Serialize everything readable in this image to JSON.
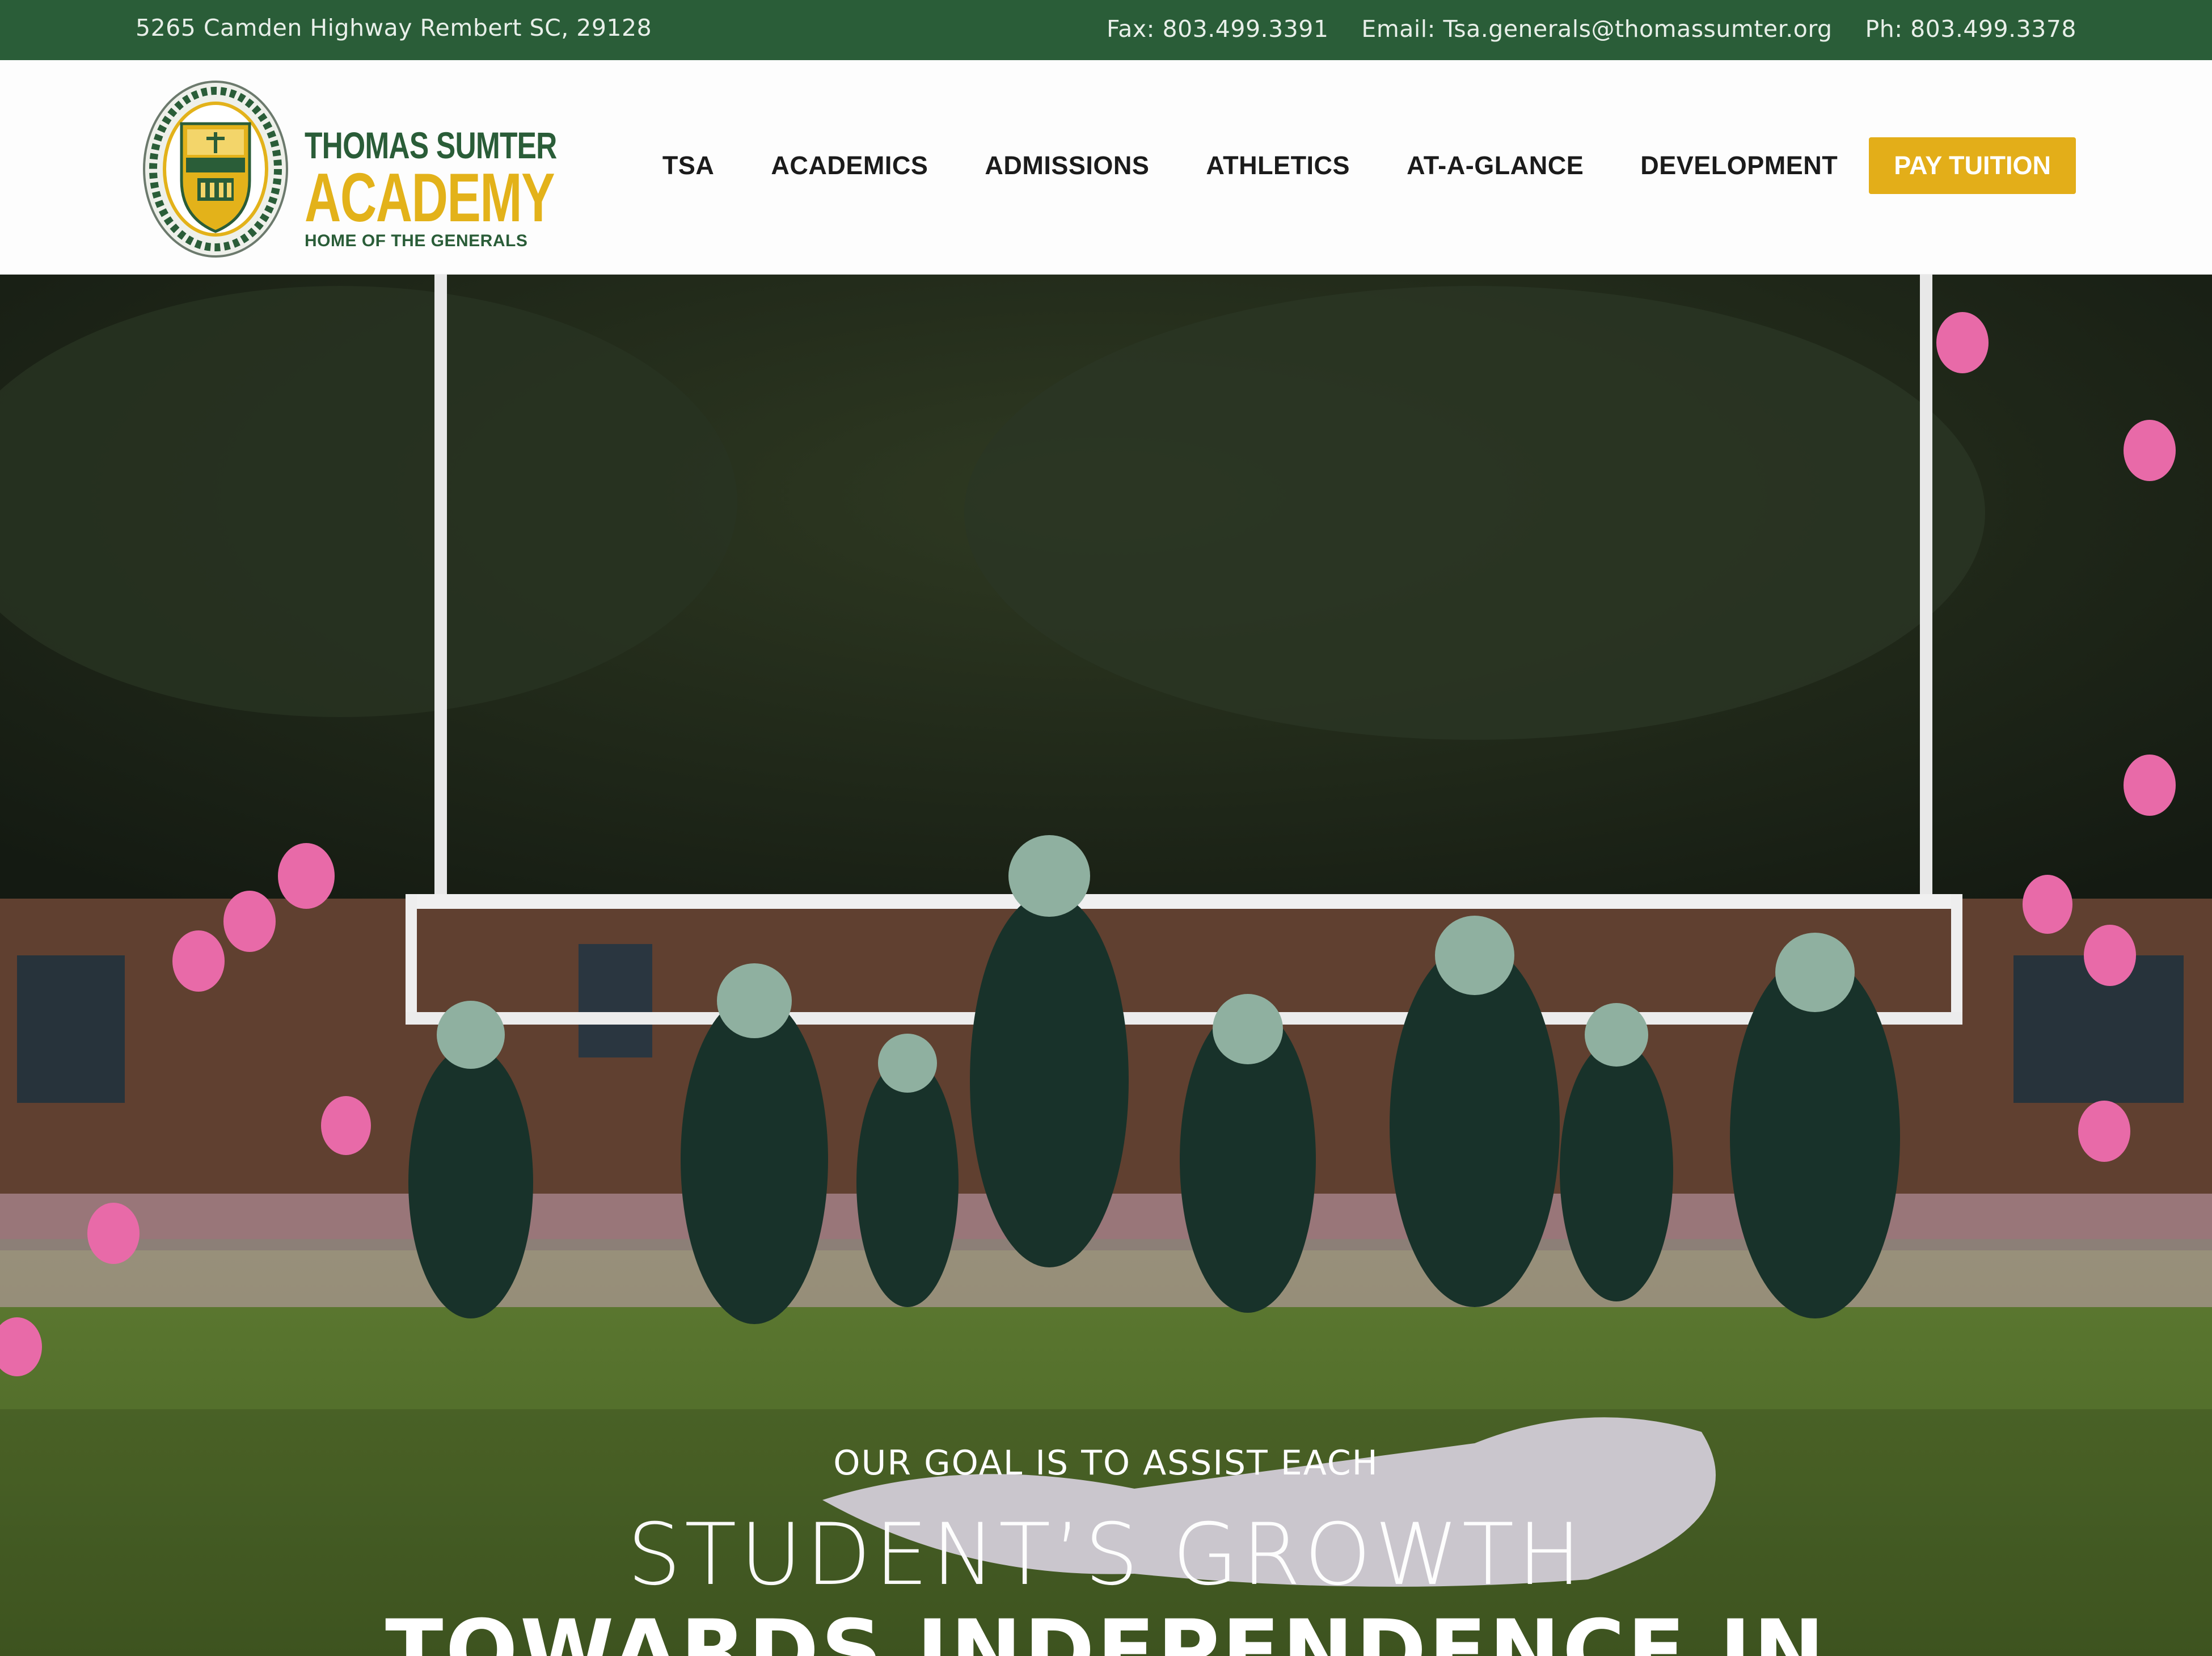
{
  "topbar": {
    "address": "5265 Camden Highway Rembert SC, 29128",
    "fax": "Fax: 803.499.3391",
    "email": "Email: Tsa.generals@thomassumter.org",
    "phone": "Ph: 803.499.3378"
  },
  "logo": {
    "line1": "THOMAS SUMTER",
    "line2": "ACADEMY",
    "tagline": "HOME OF THE GENERALS"
  },
  "nav": {
    "items": [
      "TSA",
      "ACADEMICS",
      "ADMISSIONS",
      "ATHLETICS",
      "AT-A-GLANCE",
      "DEVELOPMENT"
    ],
    "cta": "PAY TUITION"
  },
  "hero": {
    "line1": "OUR GOAL IS TO ASSIST EACH",
    "line2": "STUDENT’S GROWTH",
    "line3": "TOWARDS INDEPENDENCE IN"
  },
  "colors": {
    "brand_green": "#2a5d38",
    "brand_gold": "#e3ae19"
  }
}
